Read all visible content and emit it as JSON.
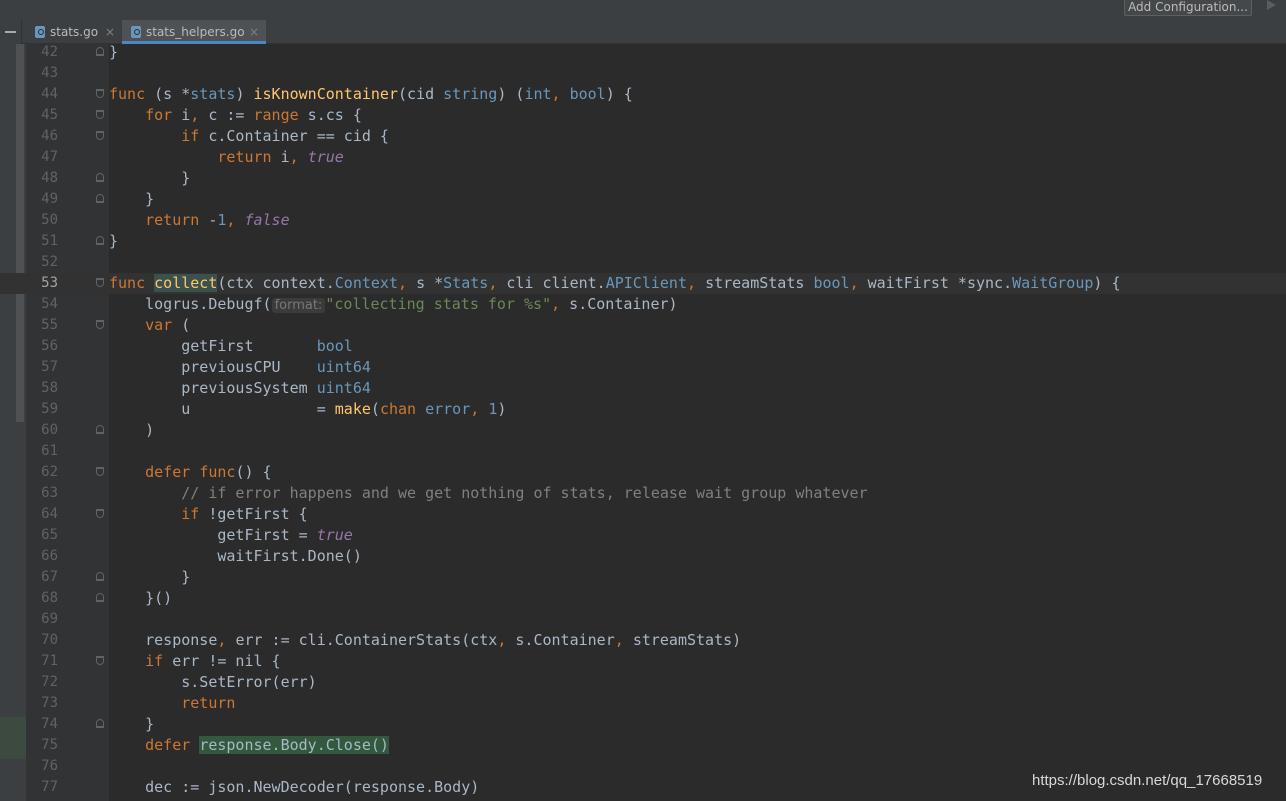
{
  "toolbar": {
    "add_configuration_label": "Add Configuration..."
  },
  "tabs": [
    {
      "label": "stats.go",
      "close": "×",
      "active": false
    },
    {
      "label": "stats_helpers.go",
      "close": "×",
      "active": true
    }
  ],
  "code_lines": [
    {
      "n": "42",
      "fold": "close",
      "t": [
        [
          "p",
          "}"
        ]
      ]
    },
    {
      "n": "43",
      "t": []
    },
    {
      "n": "44",
      "fold": "open",
      "t": [
        [
          "k",
          "func"
        ],
        [
          "p",
          " (s *"
        ],
        [
          "tp",
          "stats"
        ],
        [
          "p",
          ") "
        ],
        [
          "f",
          "isKnownContainer"
        ],
        [
          "p",
          "(cid "
        ],
        [
          "tp",
          "string"
        ],
        [
          "p",
          ") ("
        ],
        [
          "tp",
          "int"
        ],
        [
          "o",
          ", "
        ],
        [
          "tp",
          "bool"
        ],
        [
          "p",
          ") {"
        ]
      ]
    },
    {
      "n": "45",
      "fold": "open",
      "t": [
        [
          "p",
          "    "
        ],
        [
          "k",
          "for"
        ],
        [
          "p",
          " i"
        ],
        [
          "o",
          ", "
        ],
        [
          "p",
          "c := "
        ],
        [
          "k",
          "range"
        ],
        [
          "p",
          " s.cs {"
        ]
      ]
    },
    {
      "n": "46",
      "fold": "open",
      "t": [
        [
          "p",
          "        "
        ],
        [
          "k",
          "if"
        ],
        [
          "p",
          " c.Container == cid {"
        ]
      ]
    },
    {
      "n": "47",
      "t": [
        [
          "p",
          "            "
        ],
        [
          "k",
          "return"
        ],
        [
          "p",
          " i"
        ],
        [
          "o",
          ", "
        ],
        [
          "i",
          "true"
        ]
      ]
    },
    {
      "n": "48",
      "fold": "close",
      "t": [
        [
          "p",
          "        }"
        ]
      ]
    },
    {
      "n": "49",
      "fold": "close",
      "t": [
        [
          "p",
          "    }"
        ]
      ]
    },
    {
      "n": "50",
      "t": [
        [
          "p",
          "    "
        ],
        [
          "k",
          "return"
        ],
        [
          "p",
          " -"
        ],
        [
          "n",
          "1"
        ],
        [
          "o",
          ", "
        ],
        [
          "i",
          "false"
        ]
      ]
    },
    {
      "n": "51",
      "fold": "close",
      "t": [
        [
          "p",
          "}"
        ]
      ]
    },
    {
      "n": "52",
      "t": []
    },
    {
      "n": "53",
      "fold": "open",
      "cur": true,
      "t": [
        [
          "k",
          "func"
        ],
        [
          "p",
          " "
        ],
        [
          "fw",
          "collect"
        ],
        [
          "p",
          "(ctx context."
        ],
        [
          "tp",
          "Context"
        ],
        [
          "o",
          ", "
        ],
        [
          "p",
          "s *"
        ],
        [
          "tp",
          "Stats"
        ],
        [
          "o",
          ", "
        ],
        [
          "p",
          "cli client."
        ],
        [
          "tp",
          "APIClient"
        ],
        [
          "o",
          ", "
        ],
        [
          "p",
          "streamStats "
        ],
        [
          "tp",
          "bool"
        ],
        [
          "o",
          ", "
        ],
        [
          "p",
          "waitFirst *sync."
        ],
        [
          "tp",
          "WaitGroup"
        ],
        [
          "p",
          ") {"
        ]
      ]
    },
    {
      "n": "54",
      "t": [
        [
          "p",
          "    logrus.Debugf("
        ],
        [
          "h",
          "format:"
        ],
        [
          "s",
          "\"collecting stats for %s\""
        ],
        [
          "o",
          ", "
        ],
        [
          "p",
          "s.Container)"
        ]
      ]
    },
    {
      "n": "55",
      "fold": "open",
      "t": [
        [
          "p",
          "    "
        ],
        [
          "k",
          "var"
        ],
        [
          "p",
          " ("
        ]
      ]
    },
    {
      "n": "56",
      "t": [
        [
          "p",
          "        getFirst       "
        ],
        [
          "tp",
          "bool"
        ]
      ]
    },
    {
      "n": "57",
      "t": [
        [
          "p",
          "        previousCPU    "
        ],
        [
          "tp",
          "uint64"
        ]
      ]
    },
    {
      "n": "58",
      "t": [
        [
          "p",
          "        previousSystem "
        ],
        [
          "tp",
          "uint64"
        ]
      ]
    },
    {
      "n": "59",
      "t": [
        [
          "p",
          "        u              = "
        ],
        [
          "f",
          "make"
        ],
        [
          "p",
          "("
        ],
        [
          "k",
          "chan"
        ],
        [
          "p",
          " "
        ],
        [
          "tp",
          "error"
        ],
        [
          "o",
          ", "
        ],
        [
          "n",
          "1"
        ],
        [
          "p",
          ")"
        ]
      ]
    },
    {
      "n": "60",
      "fold": "close",
      "t": [
        [
          "p",
          "    )"
        ]
      ]
    },
    {
      "n": "61",
      "t": []
    },
    {
      "n": "62",
      "fold": "open",
      "t": [
        [
          "p",
          "    "
        ],
        [
          "k",
          "defer"
        ],
        [
          "p",
          " "
        ],
        [
          "k",
          "func"
        ],
        [
          "p",
          "() {"
        ]
      ]
    },
    {
      "n": "63",
      "t": [
        [
          "c",
          "        // if error happens and we get nothing of stats, release wait group whatever"
        ]
      ]
    },
    {
      "n": "64",
      "fold": "open",
      "t": [
        [
          "p",
          "        "
        ],
        [
          "k",
          "if"
        ],
        [
          "p",
          " !getFirst {"
        ]
      ]
    },
    {
      "n": "65",
      "t": [
        [
          "p",
          "            getFirst = "
        ],
        [
          "i",
          "true"
        ]
      ]
    },
    {
      "n": "66",
      "t": [
        [
          "p",
          "            waitFirst.Done()"
        ]
      ]
    },
    {
      "n": "67",
      "fold": "close",
      "t": [
        [
          "p",
          "        }"
        ]
      ]
    },
    {
      "n": "68",
      "fold": "close",
      "t": [
        [
          "p",
          "    }()"
        ]
      ]
    },
    {
      "n": "69",
      "t": []
    },
    {
      "n": "70",
      "t": [
        [
          "p",
          "    response"
        ],
        [
          "o",
          ", "
        ],
        [
          "p",
          "err := cli.ContainerStats(ctx"
        ],
        [
          "o",
          ", "
        ],
        [
          "p",
          "s.Container"
        ],
        [
          "o",
          ", "
        ],
        [
          "p",
          "streamStats)"
        ]
      ]
    },
    {
      "n": "71",
      "fold": "open",
      "t": [
        [
          "p",
          "    "
        ],
        [
          "k",
          "if"
        ],
        [
          "p",
          " err != nil {"
        ]
      ]
    },
    {
      "n": "72",
      "t": [
        [
          "p",
          "        s.SetError(err)"
        ]
      ]
    },
    {
      "n": "73",
      "t": [
        [
          "p",
          "        "
        ],
        [
          "k",
          "return"
        ]
      ]
    },
    {
      "n": "74",
      "fold": "close",
      "t": [
        [
          "p",
          "    }"
        ]
      ]
    },
    {
      "n": "75",
      "t": [
        [
          "p",
          "    "
        ],
        [
          "k",
          "defer"
        ],
        [
          "p",
          " "
        ],
        [
          "hc",
          "response.Body.Close()"
        ]
      ]
    },
    {
      "n": "76",
      "t": []
    },
    {
      "n": "77",
      "t": [
        [
          "p",
          "    dec := json.NewDecoder(response.Body)"
        ]
      ]
    }
  ],
  "watermark": "https://blog.csdn.net/qq_17668519"
}
